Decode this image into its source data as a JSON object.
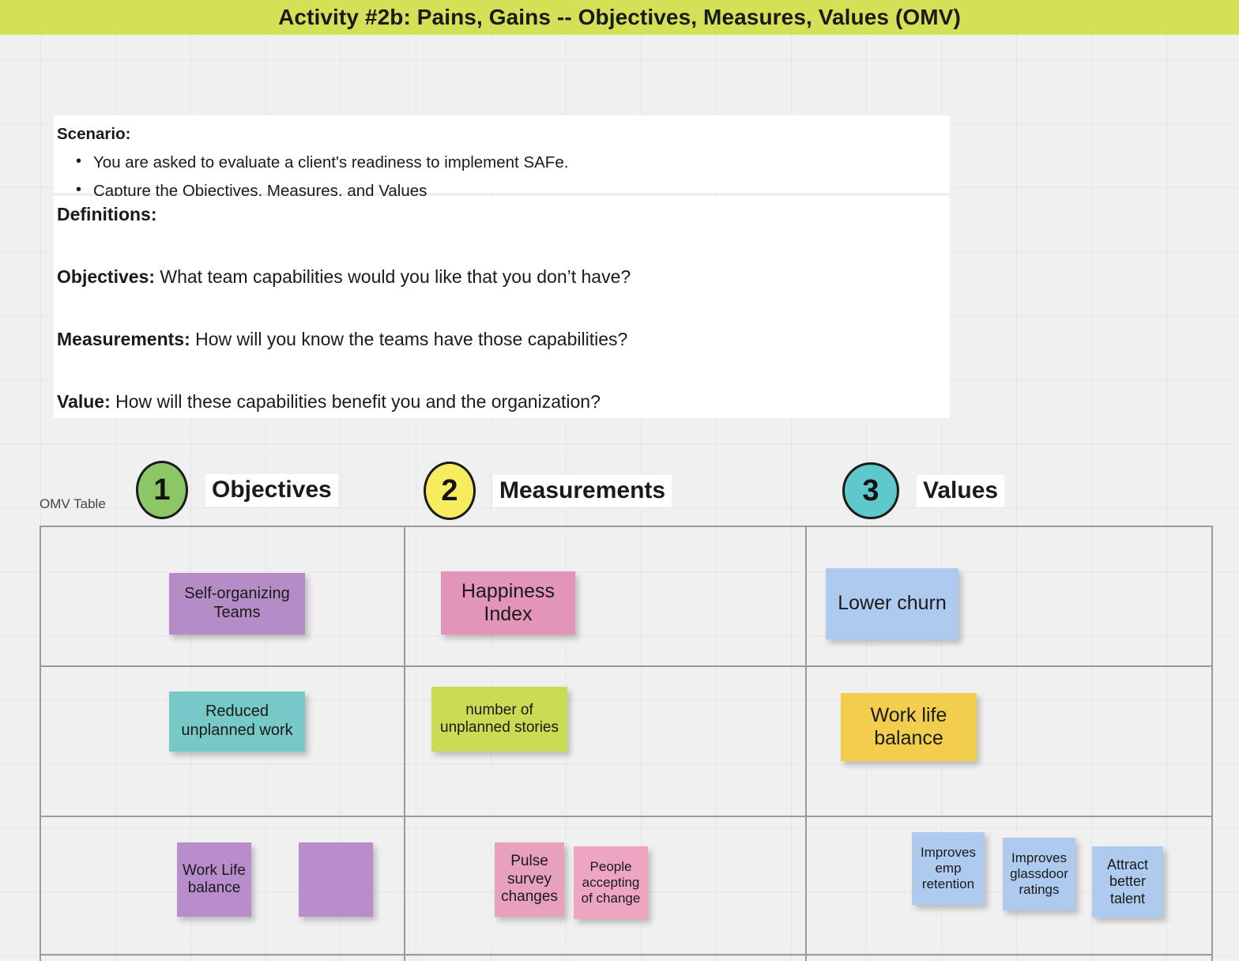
{
  "title": "Activity #2b: Pains, Gains -- Objectives, Measures, Values (OMV)",
  "colors": {
    "title_banner": "#d4e157",
    "board_background": "#f0f0f0",
    "circle_1": "#8dc765",
    "circle_2": "#f7eb60",
    "circle_3": "#5ec8cd",
    "table_border": "#9a9a9a"
  },
  "scenario": {
    "heading": "Scenario:",
    "bullets": [
      "You are asked to evaluate a client's readiness to implement SAFe.",
      "Capture the Objectives, Measures, and Values"
    ]
  },
  "definitions": {
    "heading": "Definitions:",
    "items": [
      {
        "term": "Objectives:",
        "text": " What team capabilities would you like that you don’t have?"
      },
      {
        "term": "Measurements:",
        "text": " How will you know the teams have those capabilities?"
      },
      {
        "term": "Value:",
        "text": " How will these capabilities benefit you and the organization?"
      }
    ]
  },
  "omv_table": {
    "label": "OMV Table",
    "columns": [
      {
        "number": "1",
        "title": "Objectives"
      },
      {
        "number": "2",
        "title": "Measurements"
      },
      {
        "number": "3",
        "title": "Values"
      }
    ],
    "notes": {
      "self_organizing": "Self-organizing Teams",
      "happiness_index": "Happiness Index",
      "lower_churn": "Lower churn",
      "reduced_unplanned": "Reduced unplanned work",
      "unplanned_stories": "number of unplanned stories",
      "work_life_balance": "Work life balance",
      "work_life_balance_2": "Work Life balance",
      "blank_purple": "",
      "pulse_survey": "Pulse survey changes",
      "people_accepting": "People accepting of change",
      "improves_retention": "Improves emp retention",
      "improves_glassdoor": "Improves glassdoor ratings",
      "attract_talent": "Attract better talent"
    }
  }
}
